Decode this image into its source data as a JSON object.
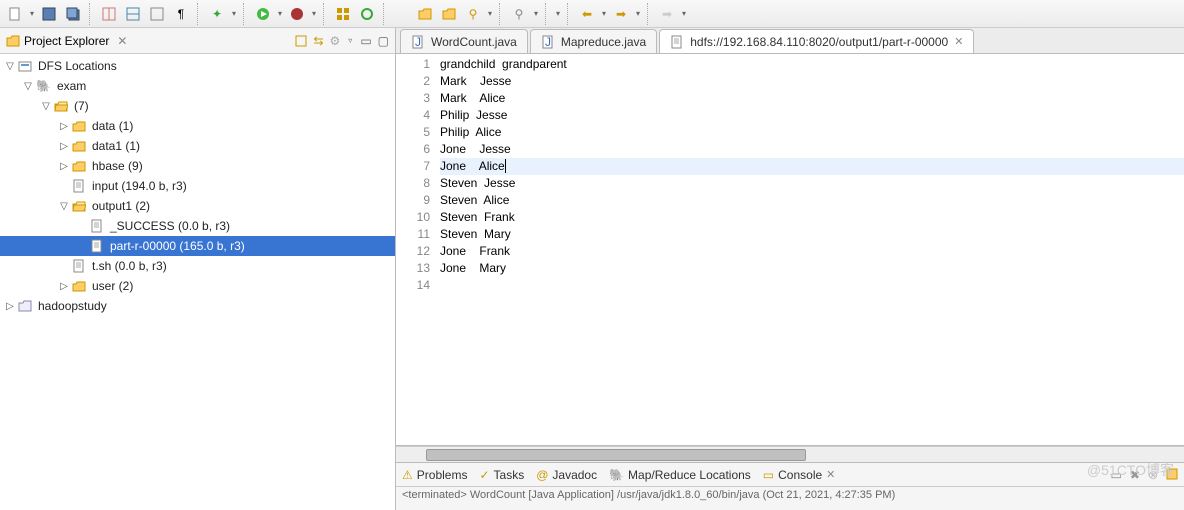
{
  "toolbar": {
    "groups": [
      [
        "new-file",
        "save",
        "save-all"
      ],
      [
        "layout1",
        "layout2",
        "layout3",
        "pilcrow"
      ],
      [
        "debug-star"
      ],
      [
        "run-green",
        "debug-bug"
      ],
      [
        "grid",
        "refresh-green"
      ],
      [
        "open-yellow",
        "open2-yellow",
        "key"
      ],
      [
        "search"
      ],
      [
        "nav1"
      ],
      [
        "back-yellow",
        "fwd-yellow"
      ],
      [
        "fwd-empty"
      ]
    ]
  },
  "explorer": {
    "title": "Project Explorer",
    "close_glyph": "✕",
    "tree": [
      {
        "depth": 0,
        "tw": "▽",
        "icon": "dfs",
        "label": "DFS Locations"
      },
      {
        "depth": 1,
        "tw": "▽",
        "icon": "elephant",
        "label": "exam"
      },
      {
        "depth": 2,
        "tw": "▽",
        "icon": "folder-open",
        "label": "(7)"
      },
      {
        "depth": 3,
        "tw": "▷",
        "icon": "folder",
        "label": "data (1)"
      },
      {
        "depth": 3,
        "tw": "▷",
        "icon": "folder",
        "label": "data1 (1)"
      },
      {
        "depth": 3,
        "tw": "▷",
        "icon": "folder",
        "label": "hbase (9)"
      },
      {
        "depth": 3,
        "tw": "",
        "icon": "file",
        "label": "input (194.0 b, r3)"
      },
      {
        "depth": 3,
        "tw": "▽",
        "icon": "folder-open",
        "label": "output1 (2)"
      },
      {
        "depth": 4,
        "tw": "",
        "icon": "file",
        "label": "_SUCCESS (0.0 b, r3)"
      },
      {
        "depth": 4,
        "tw": "",
        "icon": "file",
        "label": "part-r-00000 (165.0 b, r3)",
        "selected": true
      },
      {
        "depth": 3,
        "tw": "",
        "icon": "file",
        "label": "t.sh (0.0 b, r3)"
      },
      {
        "depth": 3,
        "tw": "▷",
        "icon": "folder",
        "label": "user (2)"
      },
      {
        "depth": 0,
        "tw": "▷",
        "icon": "project",
        "label": "hadoopstudy"
      }
    ]
  },
  "editor": {
    "tabs": [
      {
        "icon": "java",
        "label": "WordCount.java",
        "active": false
      },
      {
        "icon": "java",
        "label": "Mapreduce.java",
        "active": false
      },
      {
        "icon": "file",
        "label": "hdfs://192.168.84.110:8020/output1/part-r-00000",
        "active": true,
        "closeable": true
      }
    ],
    "lines": [
      "grandchild  grandparent",
      "Mark    Jesse",
      "Mark    Alice",
      "Philip  Jesse",
      "Philip  Alice",
      "Jone    Jesse",
      "Jone    Alice",
      "Steven  Jesse",
      "Steven  Alice",
      "Steven  Frank",
      "Steven  Mary",
      "Jone    Frank",
      "Jone    Mary",
      ""
    ],
    "highlight_line": 7
  },
  "bottom": {
    "tabs": [
      "Problems",
      "Tasks",
      "Javadoc",
      "Map/Reduce Locations",
      "Console"
    ],
    "active_tab": 4,
    "console_text": "<terminated> WordCount [Java Application] /usr/java/jdk1.8.0_60/bin/java (Oct 21, 2021, 4:27:35 PM)"
  },
  "watermark": "@51CTO博客"
}
